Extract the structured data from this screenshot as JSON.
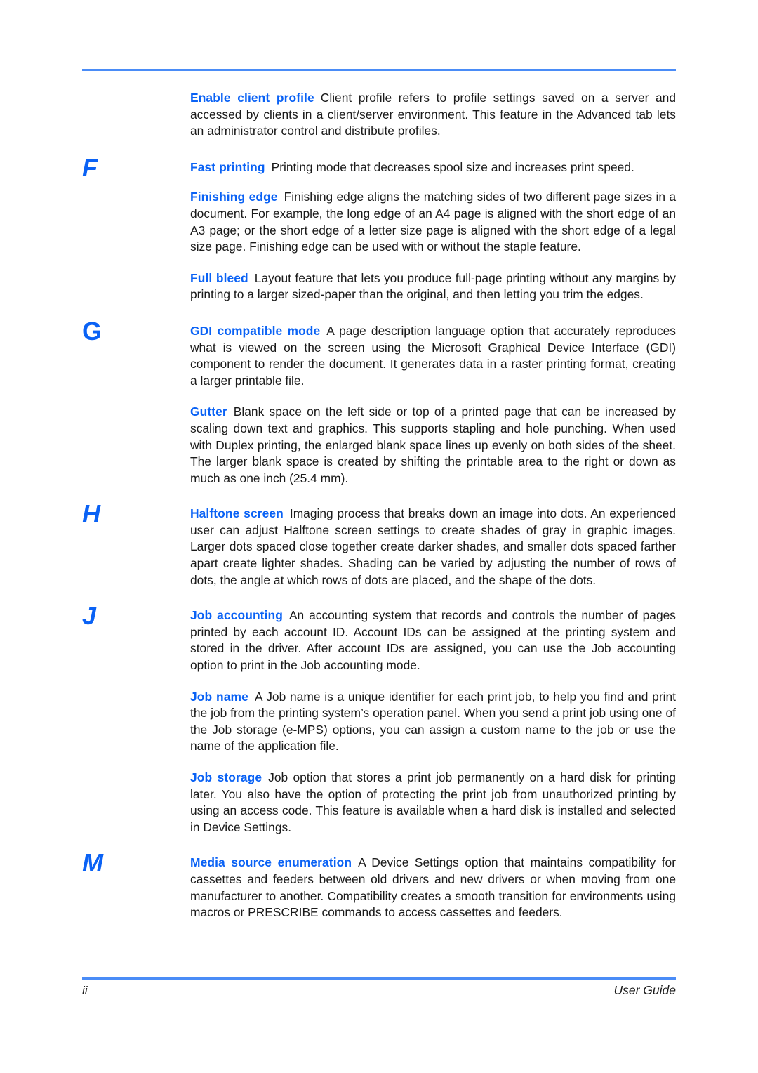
{
  "document": {
    "type": "glossary-page",
    "accent_color": "#4a8cf7",
    "heading_color": "#0a62f5",
    "body_color": "#1a1a1a"
  },
  "entries": [
    {
      "letter": "",
      "term": "Enable client profile",
      "body": "Client profile refers to profile settings saved on a server and accessed by clients in a client/server environment. This feature in the Advanced tab lets an administrator control and distribute profiles."
    },
    {
      "letter": "F",
      "term": "Fast printing",
      "body": "Printing mode that decreases spool size and increases print speed."
    },
    {
      "letter": "",
      "term": "Finishing edge",
      "body": "Finishing edge aligns the matching sides of two different page sizes in a document. For example, the long edge of an A4 page is aligned with the short edge of an A3 page; or the short edge of a letter size page is aligned with the short edge of a legal size page. Finishing edge can be used with or without the staple feature."
    },
    {
      "letter": "",
      "term": "Full bleed",
      "body": "Layout feature that lets you produce full-page printing without any margins by printing to a larger sized-paper than the original, and then letting you trim the edges."
    },
    {
      "letter": "G",
      "term": "GDI compatible mode",
      "body": "A page description language option that accurately reproduces what is viewed on the screen using the Microsoft Graphical Device Interface (GDI) component to render the document. It generates data in a raster printing format, creating a larger printable file."
    },
    {
      "letter": "",
      "term": "Gutter",
      "body": "Blank space on the left side or top of a printed page that can be increased by scaling down text and graphics. This supports stapling and hole punching. When used with Duplex printing, the enlarged blank space lines up evenly on both sides of the sheet. The larger blank space is created by shifting the printable area to the right or down as much as one inch (25.4 mm)."
    },
    {
      "letter": "H",
      "term": "Halftone screen",
      "body": "Imaging process that breaks down an image into dots. An experienced user can adjust Halftone screen settings to create shades of gray in graphic images. Larger dots spaced close together create darker shades, and smaller dots spaced farther apart create lighter shades. Shading can be varied by adjusting the number of rows of dots, the angle at which rows of dots are placed, and the shape of the dots."
    },
    {
      "letter": "J",
      "term": "Job accounting",
      "body": "An accounting system that records and controls the number of pages printed by each account ID. Account IDs can be assigned at the printing system and stored in the driver. After account IDs are assigned, you can use the Job accounting option to print in the Job accounting mode."
    },
    {
      "letter": "",
      "term": "Job name",
      "body": "A Job name is a unique identifier for each print job, to help you find and print the job from the printing system’s operation panel. When you send a print job using one of the Job storage (e-MPS) options, you can assign a custom name to the job or use the name of the application file."
    },
    {
      "letter": "",
      "term": "Job storage",
      "body": "Job option that stores a print job permanently on a hard disk for printing later. You also have the option of protecting the print job from unauthorized printing by using an access code. This feature is available when a hard disk is installed and selected in Device Settings."
    },
    {
      "letter": "M",
      "term": "Media source enumeration",
      "body": "A Device Settings option that maintains compatibility for cassettes and feeders between old drivers and new drivers or when moving from one manufacturer to another. Compatibility creates a smooth transition for environments using macros or PRESCRIBE commands to access cassettes and feeders."
    }
  ],
  "footer": {
    "page_number": "ii",
    "guide_label": "User Guide"
  }
}
